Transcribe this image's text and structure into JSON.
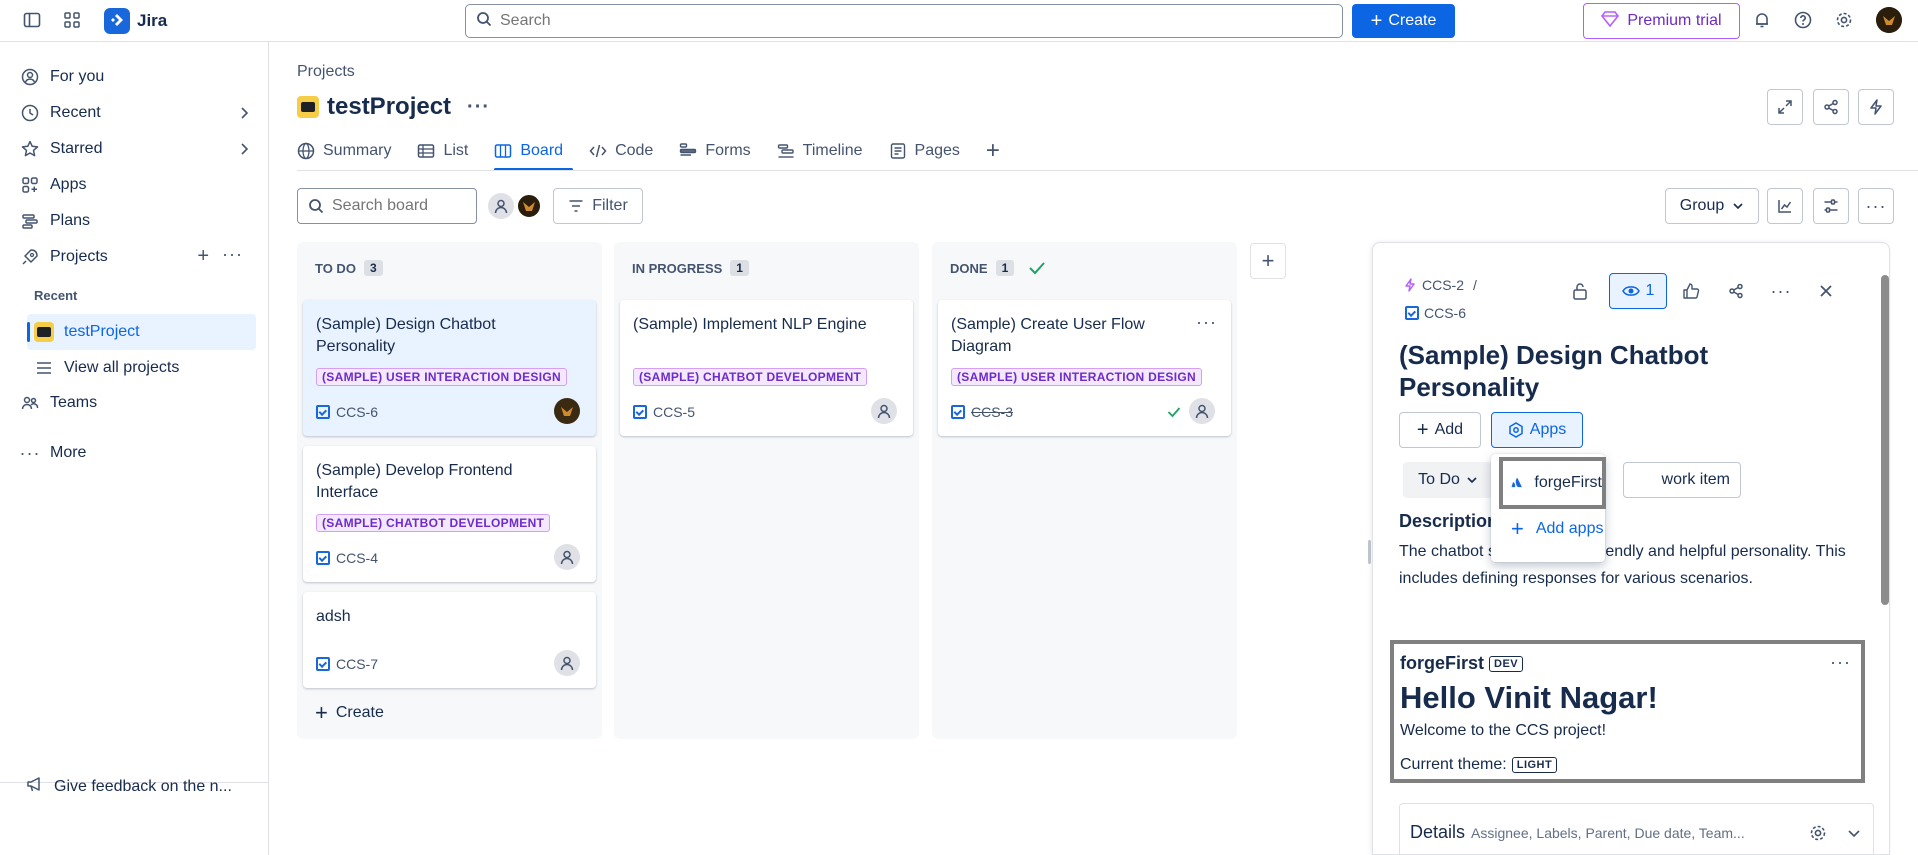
{
  "topbar": {
    "app_name": "Jira",
    "search_placeholder": "Search",
    "create_label": "Create",
    "premium_label": "Premium trial"
  },
  "sidebar": {
    "for_you": "For you",
    "recent": "Recent",
    "starred": "Starred",
    "apps": "Apps",
    "plans": "Plans",
    "projects": "Projects",
    "recent_section": "Recent",
    "current_project": "testProject",
    "view_all": "View all projects",
    "teams": "Teams",
    "more": "More",
    "feedback": "Give feedback on the n..."
  },
  "header": {
    "breadcrumb": "Projects",
    "project_title": "testProject",
    "tabs": [
      "Summary",
      "List",
      "Board",
      "Code",
      "Forms",
      "Timeline",
      "Pages"
    ],
    "active_tab": "Board"
  },
  "toolbar": {
    "search_placeholder": "Search board",
    "filter_label": "Filter",
    "group_label": "Group"
  },
  "columns": [
    {
      "title": "TO DO",
      "count": "3",
      "cards": [
        {
          "title": "(Sample) Design Chatbot Personality",
          "tag": "(SAMPLE) USER INTERACTION DESIGN",
          "key": "CCS-6"
        },
        {
          "title": "(Sample) Develop Frontend Interface",
          "tag": "(SAMPLE) CHATBOT DEVELOPMENT",
          "key": "CCS-4"
        },
        {
          "title": "adsh",
          "key": "CCS-7"
        }
      ],
      "create_label": "Create"
    },
    {
      "title": "IN PROGRESS",
      "count": "1",
      "cards": [
        {
          "title": "(Sample) Implement NLP Engine",
          "tag": "(SAMPLE) CHATBOT DEVELOPMENT",
          "key": "CCS-5"
        }
      ]
    },
    {
      "title": "DONE",
      "count": "1",
      "cards": [
        {
          "title": "(Sample) Create User Flow Diagram",
          "tag": "(SAMPLE) USER INTERACTION DESIGN",
          "key": "CCS-3"
        }
      ]
    }
  ],
  "panel": {
    "parent_key": "CCS-2",
    "separator": "/",
    "issue_key": "CCS-6",
    "watch_count": "1",
    "title": "(Sample) Design Chatbot Personality",
    "add_label": "Add",
    "apps_label": "Apps",
    "status_label": "To Do",
    "work_item_label": "work item",
    "description_heading": "Description",
    "description_text": "The chatbot should have a friendly and helpful personality. This includes defining responses for various scenarios.",
    "forge": {
      "name": "forgeFirst",
      "env": "DEV",
      "greeting": "Hello Vinit Nagar!",
      "welcome": "Welcome to the CCS project!",
      "theme_label": "Current theme:",
      "theme_value": "LIGHT"
    },
    "details_heading": "Details",
    "details_sub": "Assignee, Labels, Parent, Due date, Team..."
  },
  "dropdown": {
    "app_item": "forgeFirst",
    "add_apps": "Add apps"
  },
  "colors": {
    "primary": "#0c66e4",
    "tag_purple": "#6e2bc9",
    "premium_border": "#b35eff",
    "project_icon": "#f5cd47"
  }
}
